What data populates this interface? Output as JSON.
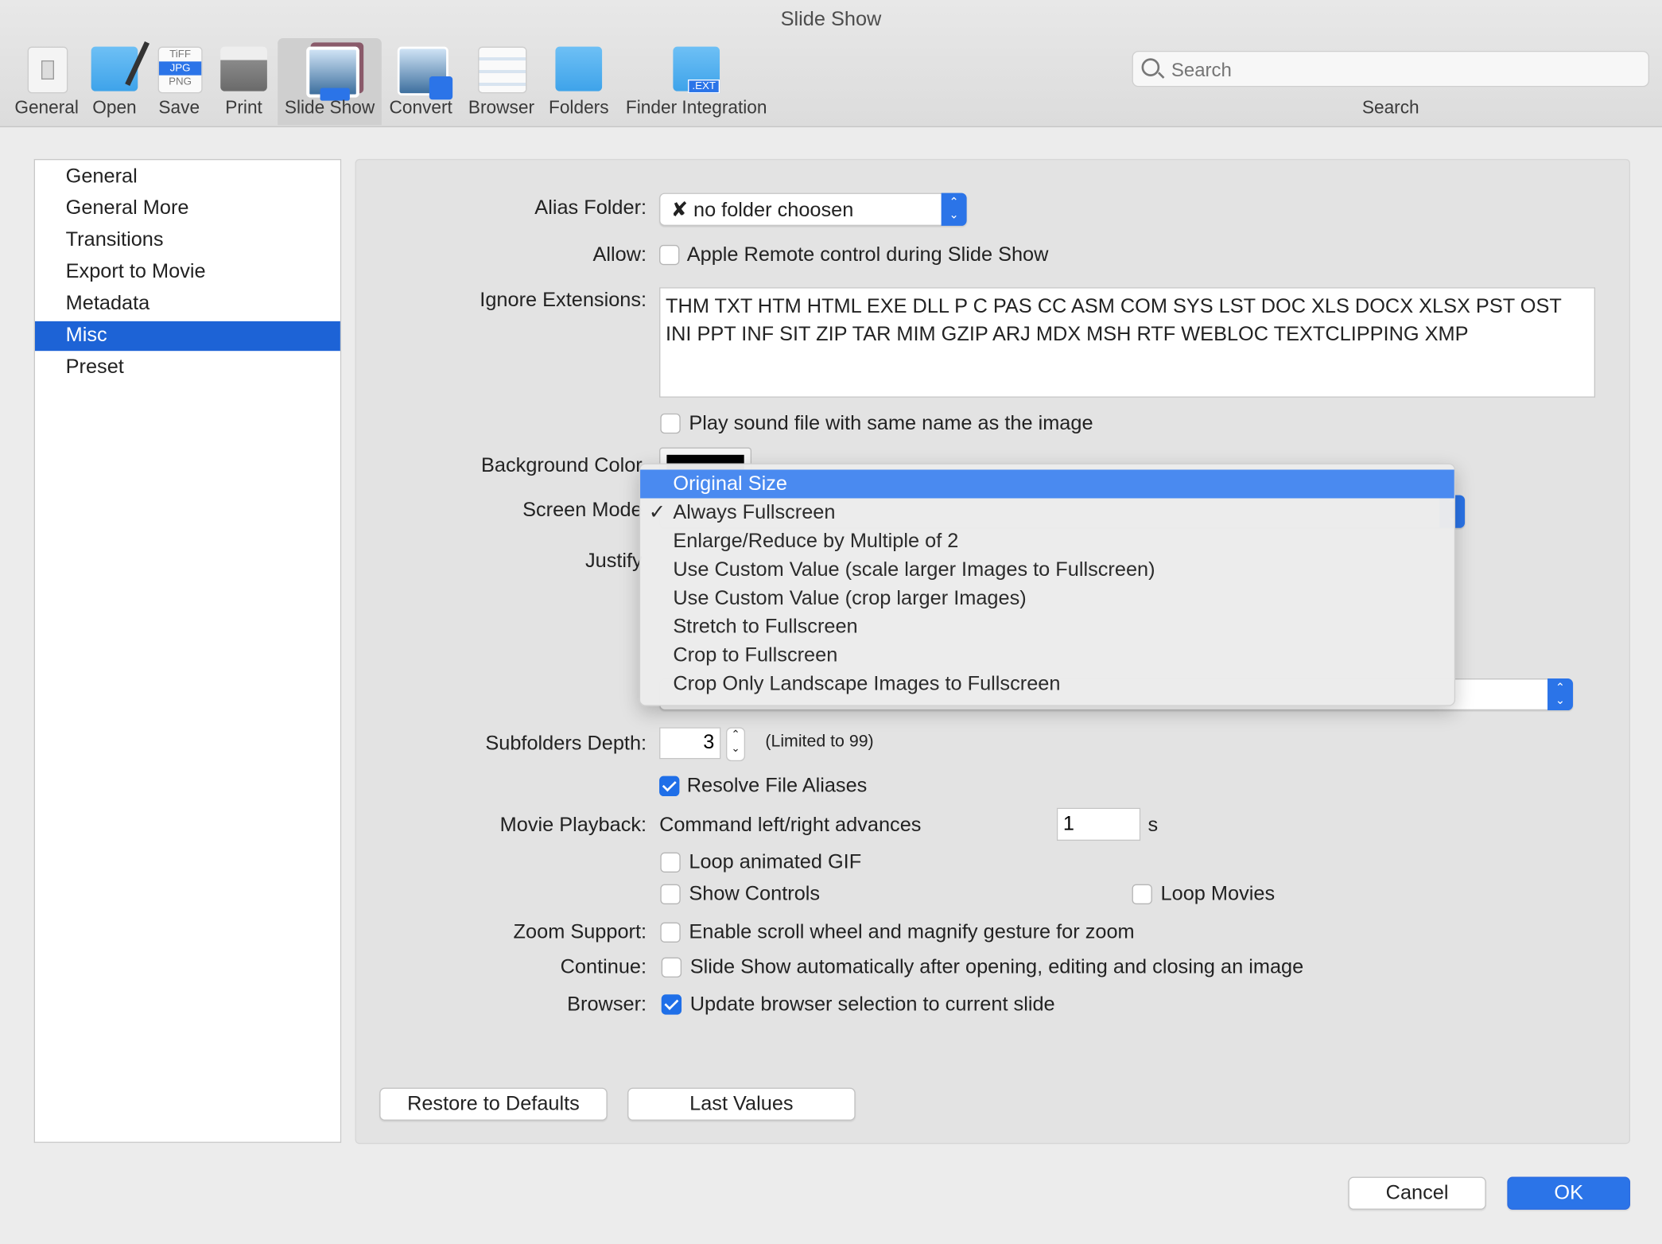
{
  "window": {
    "title": "Slide Show"
  },
  "toolbar": {
    "items": [
      {
        "label": "General",
        "icon": "light-switch-icon"
      },
      {
        "label": "Open",
        "icon": "folder-brush-icon"
      },
      {
        "label": "Save",
        "icon": "file-formats-icon",
        "formats": [
          "TiFF",
          "JPG",
          "PNG"
        ]
      },
      {
        "label": "Print",
        "icon": "printer-icon"
      },
      {
        "label": "Slide Show",
        "icon": "slideshow-icon",
        "selected": true
      },
      {
        "label": "Convert",
        "icon": "convert-icon"
      },
      {
        "label": "Browser",
        "icon": "browser-icon"
      },
      {
        "label": "Folders",
        "icon": "folders-icon"
      },
      {
        "label": "Finder Integration",
        "icon": "finder-ext-icon",
        "badge": ".EXT"
      }
    ],
    "search": {
      "placeholder": "Search",
      "label": "Search"
    }
  },
  "sidebar": {
    "items": [
      {
        "label": "General"
      },
      {
        "label": "General More"
      },
      {
        "label": "Transitions"
      },
      {
        "label": "Export to Movie"
      },
      {
        "label": "Metadata"
      },
      {
        "label": "Misc",
        "selected": true
      },
      {
        "label": "Preset"
      }
    ]
  },
  "form": {
    "alias_folder": {
      "label": "Alias Folder:",
      "value": "✘ no folder choosen"
    },
    "allow": {
      "label": "Allow:",
      "option": "Apple Remote control during Slide Show",
      "checked": false
    },
    "ignore_extensions": {
      "label": "Ignore Extensions:",
      "value": "THM TXT HTM HTML EXE DLL P C PAS CC ASM COM SYS LST DOC XLS DOCX XLSX PST OST INI PPT INF SIT ZIP TAR MIM GZIP ARJ MDX MSH RTF WEBLOC TEXTCLIPPING XMP"
    },
    "play_sound": {
      "label": "Play sound file with same name as the image",
      "checked": false
    },
    "background_color": {
      "label": "Background Color",
      "value": "#000000"
    },
    "screen_mode": {
      "label": "Screen Mode",
      "selected": "Always Fullscreen"
    },
    "justify": {
      "label": "Justify"
    },
    "subfolders_depth": {
      "label": "Subfolders Depth:",
      "value": "3",
      "note": "(Limited to 99)"
    },
    "resolve_aliases": {
      "label": "Resolve File Aliases",
      "checked": true
    },
    "movie_playback": {
      "label": "Movie Playback:",
      "text": "Command left/right advances",
      "value": "1",
      "unit": "s"
    },
    "loop_gif": {
      "label": "Loop animated GIF",
      "checked": false
    },
    "show_controls": {
      "label": "Show Controls",
      "checked": false
    },
    "loop_movies": {
      "label": "Loop Movies",
      "checked": false
    },
    "zoom_support": {
      "label": "Zoom Support:",
      "option": "Enable scroll wheel and magnify gesture for zoom",
      "checked": false
    },
    "continue": {
      "label": "Continue:",
      "option": "Slide Show automatically after opening, editing and closing an image",
      "checked": false
    },
    "browser": {
      "label": "Browser:",
      "option": "Update browser selection to current slide",
      "checked": true
    },
    "restore_defaults": "Restore to Defaults",
    "last_values": "Last Values"
  },
  "screen_mode_menu": {
    "items": [
      {
        "label": "Original Size",
        "highlighted": true
      },
      {
        "label": "Always Fullscreen",
        "checked": true
      },
      {
        "label": "Enlarge/Reduce by Multiple of 2"
      },
      {
        "label": "Use Custom Value (scale larger Images to Fullscreen)"
      },
      {
        "label": "Use Custom Value (crop larger Images)"
      },
      {
        "label": "Stretch to Fullscreen"
      },
      {
        "label": "Crop to Fullscreen"
      },
      {
        "label": "Crop Only Landscape Images to Fullscreen"
      }
    ],
    "check_glyph": "✓"
  },
  "footer": {
    "cancel": "Cancel",
    "ok": "OK"
  },
  "colors": {
    "accent": "#1f6fe8",
    "selection": "#1d63d6",
    "menu_highlight": "#4a8af0"
  }
}
